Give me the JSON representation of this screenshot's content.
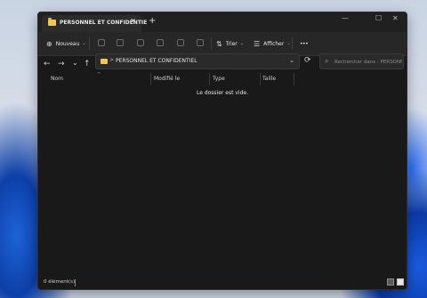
{
  "tab": {
    "title": "PERSONNEL ET CONFIDENTIE",
    "close": "✕",
    "new": "+"
  },
  "window_controls": {
    "minimize": "—",
    "maximize": "☐",
    "close": "✕"
  },
  "toolbar": {
    "new_label": "Nouveau",
    "new_icon": "⊕",
    "sort_label": "Trier",
    "sort_icon": "⇅",
    "view_label": "Afficher",
    "view_icon": "☰",
    "more": "•••",
    "chevron": "⌄"
  },
  "nav": {
    "back": "←",
    "forward": "→",
    "recent": "⌄",
    "up": "↑",
    "refresh": "⟳"
  },
  "address": {
    "separator": ">",
    "path": "PERSONNEL ET CONFIDENTIEL",
    "dropdown": "⌄"
  },
  "search": {
    "placeholder": "Rechercher dans : PERSONNEL",
    "icon": "⌕"
  },
  "columns": {
    "name": "Nom",
    "modified": "Modifié le",
    "type": "Type",
    "size": "Taille",
    "sort_arrow": "^"
  },
  "content": {
    "empty_message": "Le dossier est vide."
  },
  "status": {
    "count": "0 élément(s)"
  },
  "colors": {
    "folder": "#f2c94c",
    "window_bg": "#191919",
    "toolbar_bg": "#272727"
  }
}
